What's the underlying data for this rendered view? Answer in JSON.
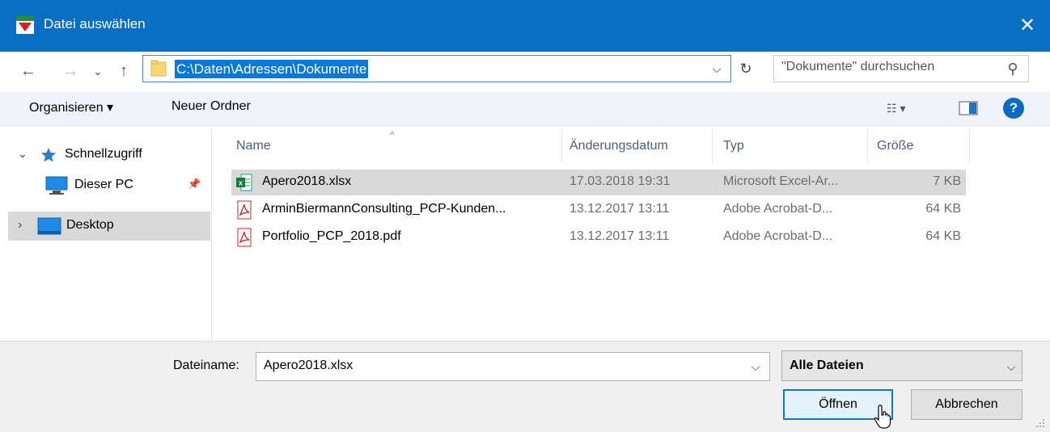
{
  "window": {
    "title": "Datei auswählen",
    "close_glyph": "✕"
  },
  "nav": {
    "back_glyph": "←",
    "forward_glyph": "→",
    "recent_glyph": "⌄",
    "up_glyph": "↑",
    "address": "C:\\Daten\\Adressen\\Dokumente",
    "address_drop_glyph": "⌵",
    "refresh_glyph": "↻",
    "search_placeholder": "\"Dokumente\" durchsuchen",
    "search_glyph": "⚲"
  },
  "toolbar": {
    "organize_label": "Organisieren ▾",
    "new_folder_label": "Neuer Ordner",
    "view_glyph": "☷ ▾",
    "help_glyph": "?"
  },
  "navpane": {
    "items": [
      {
        "label": "Schnellzugriff",
        "expander": "⌄",
        "icon": "star-icon"
      },
      {
        "label": "Dieser PC",
        "icon": "computer-icon",
        "pin": "📌"
      },
      {
        "label": "Desktop",
        "expander": "›",
        "icon": "desktop-icon"
      }
    ]
  },
  "list": {
    "columns": [
      "Name",
      "Änderungsdatum",
      "Typ",
      "Größe"
    ],
    "sort_glyph": "^",
    "rows": [
      {
        "name": "Apero2018.xlsx",
        "date": "17.03.2018 19:31",
        "type": "Microsoft Excel-Ar...",
        "size": "7 KB",
        "icon": "excel-icon"
      },
      {
        "name": "ArminBiermannConsulting_PCP-Kunden...",
        "date": "13.12.2017 13:11",
        "type": "Adobe Acrobat-D...",
        "size": "64 KB",
        "icon": "pdf-icon"
      },
      {
        "name": "Portfolio_PCP_2018.pdf",
        "date": "13.12.2017 13:11",
        "type": "Adobe Acrobat-D...",
        "size": "64 KB",
        "icon": "pdf-icon"
      }
    ]
  },
  "bottom": {
    "filename_label": "Dateiname:",
    "filename_value": "Apero2018.xlsx",
    "filter_value": "Alle Dateien",
    "drop_glyph": "⌵",
    "open_label": "Öffnen",
    "cancel_label": "Abbrechen"
  },
  "colors": {
    "titlebar": "#0a6fc2",
    "selection": "#0a78d7",
    "row_selected": "#d9d9d9"
  }
}
